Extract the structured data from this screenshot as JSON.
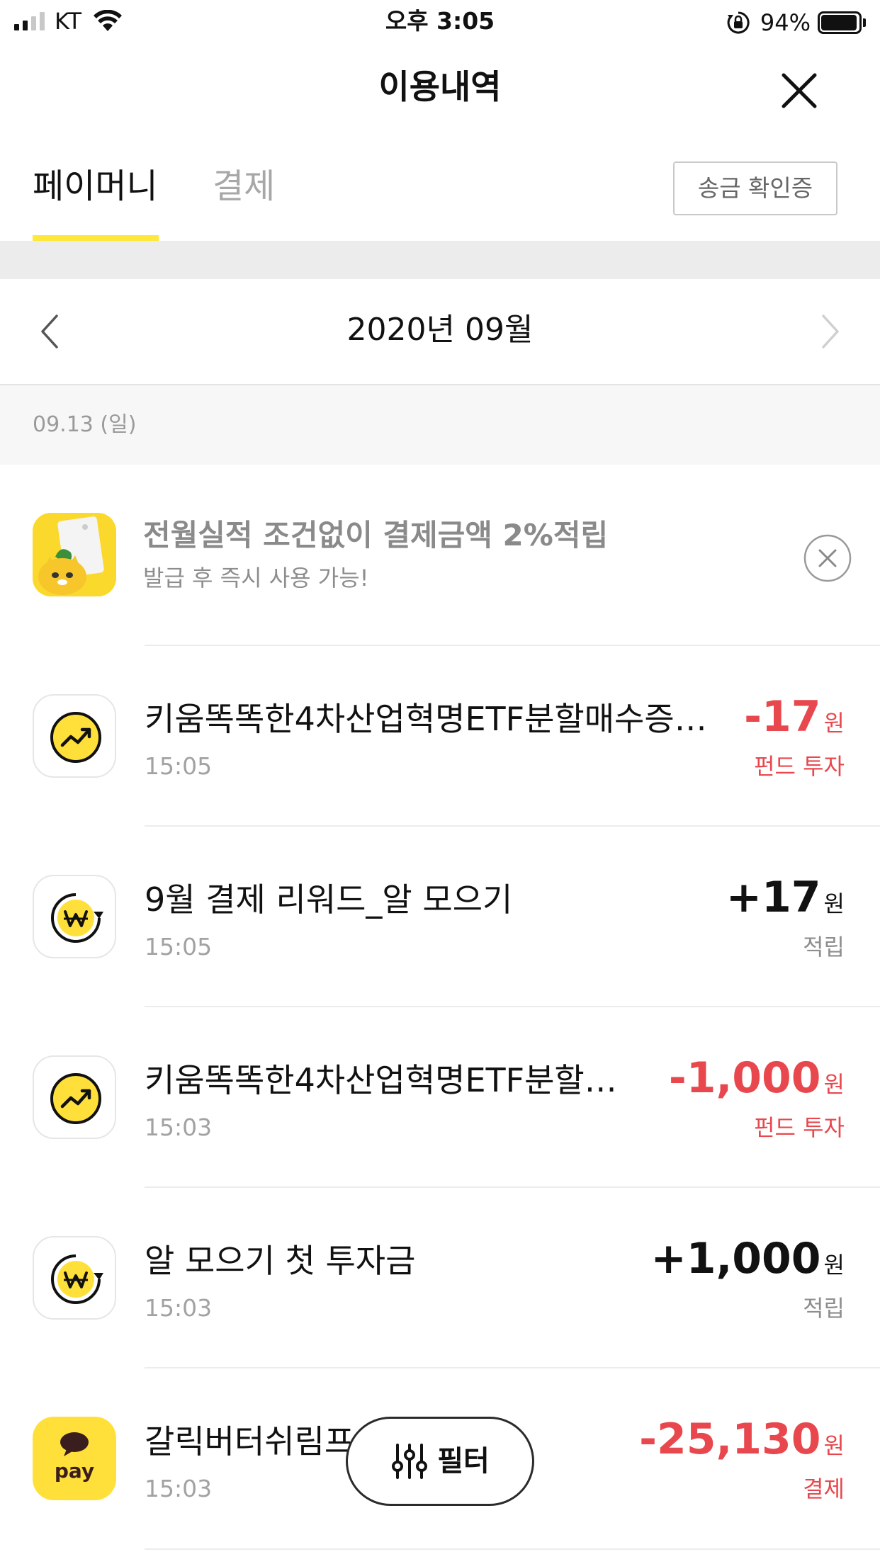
{
  "status_bar": {
    "carrier": "KT",
    "time": "오후 3:05",
    "battery": "94%",
    "battery_level": 0.94
  },
  "header": {
    "title": "이용내역",
    "close_icon": "close-icon"
  },
  "tabs": {
    "items": [
      {
        "label": "페이머니",
        "active": true
      },
      {
        "label": "결제",
        "active": false
      }
    ],
    "receipt_button": "송금 확인증",
    "active_underline_color": "#ffe83a"
  },
  "month_nav": {
    "label": "2020년 09월",
    "prev_icon": "chevron-left-icon",
    "next_icon": "chevron-right-icon"
  },
  "date_header": "09.13 (일)",
  "promo": {
    "title": "전월실적 조건없이 결제금액 2%적립",
    "subtitle": "발급 후 즉시 사용 가능!",
    "icon": "card-promo-icon",
    "close_icon": "close-circle-icon"
  },
  "transactions": [
    {
      "icon": "investment-chart-icon",
      "title": "키움똑똑한4차산업혁명ETF분할매수증…",
      "time": "15:05",
      "amount": "-17",
      "unit": "원",
      "category": "펀드 투자",
      "color": "#e8484d"
    },
    {
      "icon": "won-reward-icon",
      "title": "9월 결제 리워드_알 모으기",
      "time": "15:05",
      "amount": "+17",
      "unit": "원",
      "category": "적립",
      "color": "#111111"
    },
    {
      "icon": "investment-chart-icon",
      "title": "키움똑똑한4차산업혁명ETF분할…",
      "time": "15:03",
      "amount": "-1,000",
      "unit": "원",
      "category": "펀드 투자",
      "color": "#e8484d"
    },
    {
      "icon": "won-reward-icon",
      "title": "알 모으기 첫 투자금",
      "time": "15:03",
      "amount": "+1,000",
      "unit": "원",
      "category": "적립",
      "color": "#111111"
    },
    {
      "icon": "kakao-pay-icon",
      "title": "갈릭버터쉬림프",
      "time": "15:03",
      "amount": "-25,130",
      "unit": "원",
      "category": "결제",
      "color": "#e8484d"
    }
  ],
  "pay_icon_label": "pay",
  "filter": {
    "label": "필터",
    "icon": "filter-sliders-icon"
  },
  "colors": {
    "accent_yellow": "#ffe03a",
    "negative_red": "#e8484d"
  }
}
